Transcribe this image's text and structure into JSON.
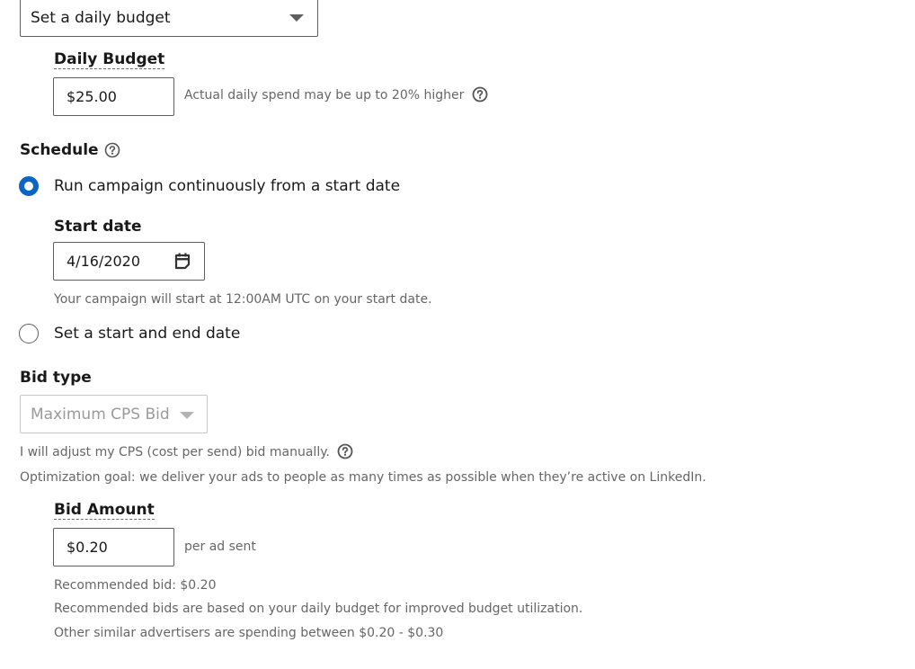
{
  "budget": {
    "type_select": {
      "value": "Set a daily budget",
      "icon": "caret-down-icon"
    },
    "daily_budget_label": "Daily Budget",
    "daily_budget_value": "$25.00",
    "daily_budget_hint": "Actual daily spend may be up to 20% higher",
    "help_icon": "question-circle-icon"
  },
  "schedule": {
    "title": "Schedule",
    "help_icon": "question-circle-icon",
    "options": [
      {
        "label": "Run campaign continuously from a start date",
        "checked": true
      },
      {
        "label": "Set a start and end date",
        "checked": false
      }
    ],
    "start_date_label": "Start date",
    "start_date_value": "4/16/2020",
    "calendar_icon": "calendar-icon",
    "start_date_hint": "Your campaign will start at 12:00AM UTC on your start date."
  },
  "bid": {
    "title": "Bid type",
    "type_select": {
      "value": "Maximum CPS Bid",
      "disabled": true,
      "icon": "caret-down-icon"
    },
    "manual_note": "I will adjust my CPS (cost per send) bid manually.",
    "optimization_note": "Optimization goal: we deliver your ads to people as many times as possible when they’re active on LinkedIn.",
    "amount_label": "Bid Amount",
    "amount_value": "$0.20",
    "amount_suffix": "per ad sent",
    "recommended": "Recommended bid: $0.20",
    "recommended_basis": "Recommended bids are based on your daily budget for improved budget utilization.",
    "similar_range": "Other similar advertisers are spending between $0.20 - $0.30"
  },
  "colors": {
    "accent": "#0a66c2",
    "hint_text": "#666666",
    "border": "#5e5e5e",
    "disabled_border": "#c6c6c6"
  }
}
